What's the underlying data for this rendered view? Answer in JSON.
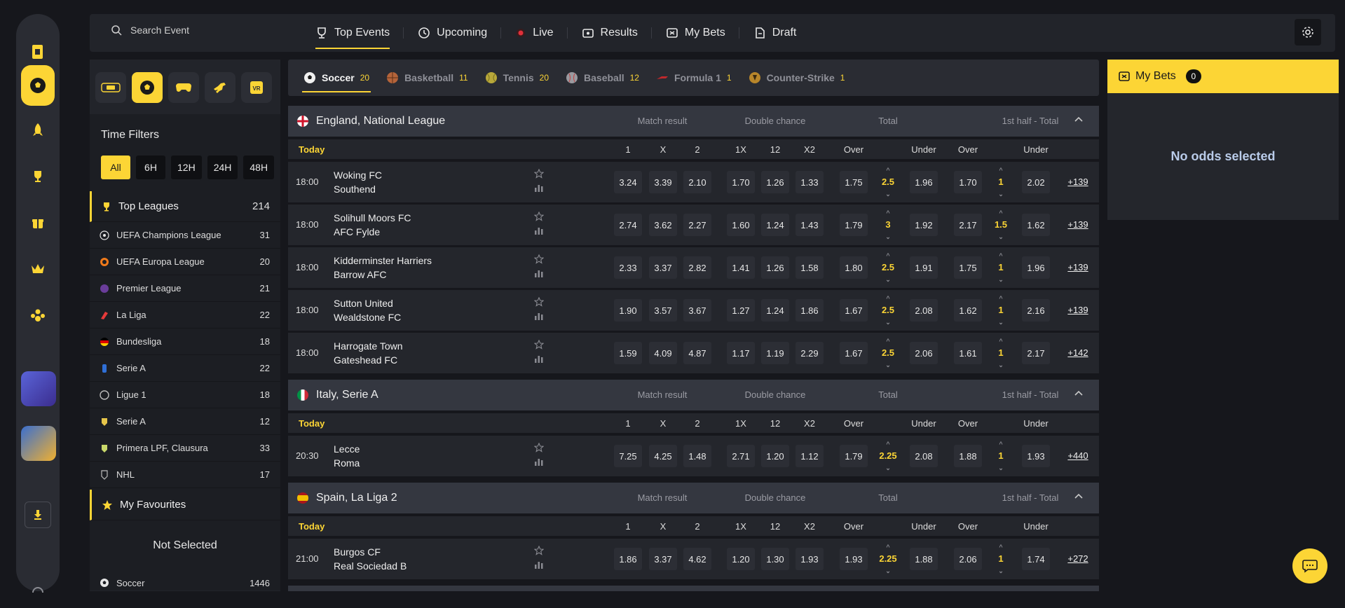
{
  "search": {
    "placeholder": "Search Event"
  },
  "nav_tabs": [
    {
      "label": "Top Events",
      "icon": "trophy-icon"
    },
    {
      "label": "Upcoming",
      "icon": "clock-icon"
    },
    {
      "label": "Live",
      "icon": "live-dot-icon"
    },
    {
      "label": "Results",
      "icon": "ticket-icon"
    },
    {
      "label": "My Bets",
      "icon": "coupon-icon"
    },
    {
      "label": "Draft",
      "icon": "draft-icon"
    }
  ],
  "time_filters": {
    "title": "Time Filters",
    "options": [
      "All",
      "6H",
      "12H",
      "24H",
      "48H"
    ],
    "selected": "All"
  },
  "top_leagues": {
    "label": "Top Leagues",
    "count": "214"
  },
  "leagues": [
    {
      "name": "UEFA Champions League",
      "count": "31"
    },
    {
      "name": "UEFA Europa League",
      "count": "20"
    },
    {
      "name": "Premier League",
      "count": "21"
    },
    {
      "name": "La Liga",
      "count": "22"
    },
    {
      "name": "Bundesliga",
      "count": "18"
    },
    {
      "name": "Serie A",
      "count": "22"
    },
    {
      "name": "Ligue 1",
      "count": "18"
    },
    {
      "name": "Serie A",
      "count": "12"
    },
    {
      "name": "Primera LPF, Clausura",
      "count": "33"
    },
    {
      "name": "NHL",
      "count": "17"
    }
  ],
  "favourites": {
    "label": "My Favourites",
    "empty": "Not Selected"
  },
  "sport_list": [
    {
      "name": "Soccer",
      "count": "1446"
    }
  ],
  "sport_tabs": [
    {
      "name": "Soccer",
      "count": "20"
    },
    {
      "name": "Basketball",
      "count": "11"
    },
    {
      "name": "Tennis",
      "count": "20"
    },
    {
      "name": "Baseball",
      "count": "12"
    },
    {
      "name": "Formula 1",
      "count": "1"
    },
    {
      "name": "Counter-Strike",
      "count": "1"
    }
  ],
  "market_headers": [
    "Match result",
    "Double chance",
    "Total",
    "1st half - Total"
  ],
  "col_headers": [
    "1",
    "X",
    "2",
    "1X",
    "12",
    "X2",
    "Over",
    "Under",
    "Over",
    "Under"
  ],
  "today_label": "Today",
  "sections": [
    {
      "league": "England, National League",
      "matches": [
        {
          "time": "18:00",
          "home": "Woking FC",
          "away": "Southend",
          "odds": [
            "3.24",
            "3.39",
            "2.10",
            "1.70",
            "1.26",
            "1.33",
            "1.75",
            "1.96",
            "1.70",
            "2.02"
          ],
          "total": "2.5",
          "half": "1",
          "more": "+139"
        },
        {
          "time": "18:00",
          "home": "Solihull Moors FC",
          "away": "AFC Fylde",
          "odds": [
            "2.74",
            "3.62",
            "2.27",
            "1.60",
            "1.24",
            "1.43",
            "1.79",
            "1.92",
            "2.17",
            "1.62"
          ],
          "total": "3",
          "half": "1.5",
          "more": "+139"
        },
        {
          "time": "18:00",
          "home": "Kidderminster Harriers",
          "away": "Barrow AFC",
          "odds": [
            "2.33",
            "3.37",
            "2.82",
            "1.41",
            "1.26",
            "1.58",
            "1.80",
            "1.91",
            "1.75",
            "1.96"
          ],
          "total": "2.5",
          "half": "1",
          "more": "+139"
        },
        {
          "time": "18:00",
          "home": "Sutton United",
          "away": "Wealdstone FC",
          "odds": [
            "1.90",
            "3.57",
            "3.67",
            "1.27",
            "1.24",
            "1.86",
            "1.67",
            "2.08",
            "1.62",
            "2.16"
          ],
          "total": "2.5",
          "half": "1",
          "more": "+139"
        },
        {
          "time": "18:00",
          "home": "Harrogate Town",
          "away": "Gateshead FC",
          "odds": [
            "1.59",
            "4.09",
            "4.87",
            "1.17",
            "1.19",
            "2.29",
            "1.67",
            "2.06",
            "1.61",
            "2.17"
          ],
          "total": "2.5",
          "half": "1",
          "more": "+142"
        }
      ]
    },
    {
      "league": "Italy, Serie A",
      "matches": [
        {
          "time": "20:30",
          "home": "Lecce",
          "away": "Roma",
          "odds": [
            "7.25",
            "4.25",
            "1.48",
            "2.71",
            "1.20",
            "1.12",
            "1.79",
            "2.08",
            "1.88",
            "1.93"
          ],
          "total": "2.25",
          "half": "1",
          "more": "+440"
        }
      ]
    },
    {
      "league": "Spain, La Liga 2",
      "matches": [
        {
          "time": "21:00",
          "home": "Burgos CF",
          "away": "Real Sociedad B",
          "odds": [
            "1.86",
            "3.37",
            "4.62",
            "1.20",
            "1.30",
            "1.93",
            "1.93",
            "1.88",
            "2.06",
            "1.74"
          ],
          "total": "2.25",
          "half": "1",
          "more": "+272"
        }
      ]
    }
  ],
  "bet_slip": {
    "title": "My Bets",
    "count": "0",
    "empty": "No odds selected"
  },
  "colors": {
    "accent": "#fcd535",
    "background": "#16171c",
    "panel": "#24262c"
  }
}
